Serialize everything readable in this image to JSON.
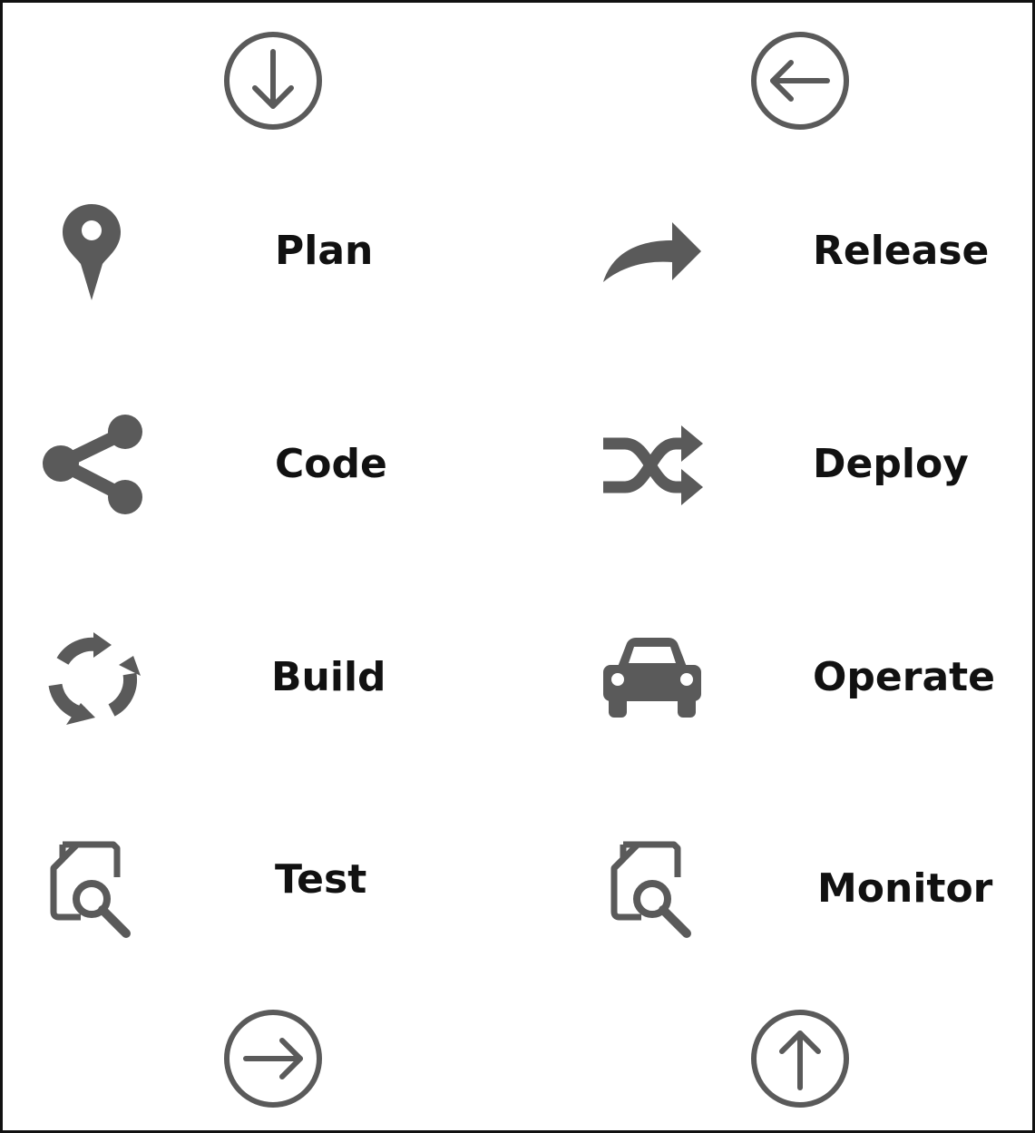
{
  "colors": {
    "icon": "#5a5a5a",
    "text": "#111111",
    "border": "#111111",
    "background": "#ffffff"
  },
  "arrows": {
    "top_left": "arrow-down-circle-icon",
    "top_right": "arrow-left-circle-icon",
    "bottom_left": "arrow-right-circle-icon",
    "bottom_right": "arrow-up-circle-icon"
  },
  "stages": {
    "left": [
      {
        "label": "Plan",
        "icon": "map-pin-icon"
      },
      {
        "label": "Code",
        "icon": "share-icon"
      },
      {
        "label": "Build",
        "icon": "refresh-cycle-icon"
      },
      {
        "label": "Test",
        "icon": "document-search-icon"
      }
    ],
    "right": [
      {
        "label": "Release",
        "icon": "forward-arrow-icon"
      },
      {
        "label": "Deploy",
        "icon": "shuffle-icon"
      },
      {
        "label": "Operate",
        "icon": "car-icon"
      },
      {
        "label": "Monitor",
        "icon": "document-search-icon"
      }
    ]
  }
}
